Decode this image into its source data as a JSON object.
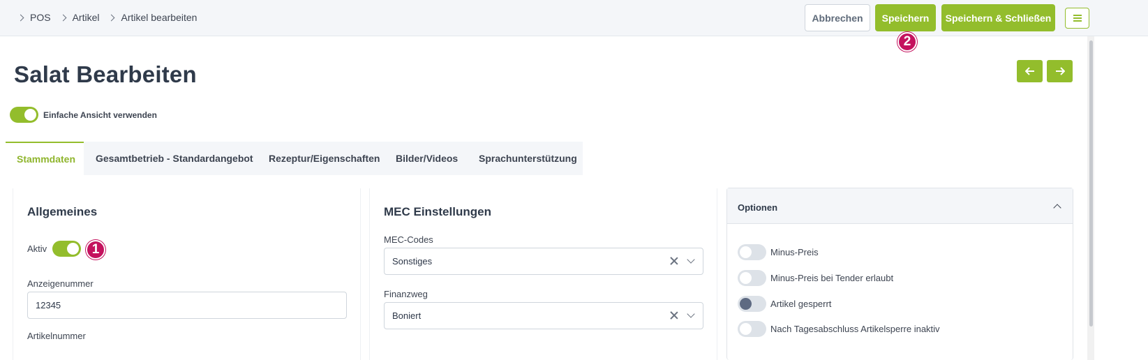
{
  "breadcrumb": [
    "POS",
    "Artikel",
    "Artikel bearbeiten"
  ],
  "header": {
    "cancel_label": "Abbrechen",
    "save_label": "Speichern",
    "save_close_label": "Speichern & Schließen"
  },
  "markers": {
    "one": "1",
    "two": "2"
  },
  "page_title": "Salat Bearbeiten",
  "simple_view": {
    "label": "Einfache Ansicht verwenden",
    "enabled": true
  },
  "tabs": [
    {
      "label": "Stammdaten",
      "active": true
    },
    {
      "label": "Gesamtbetrieb - Standardangebot",
      "active": false
    },
    {
      "label": "Rezeptur/Eigenschaften",
      "active": false
    },
    {
      "label": "Bilder/Videos",
      "active": false
    },
    {
      "label": "Sprachunterstützung",
      "active": false
    }
  ],
  "general": {
    "title": "Allgemeines",
    "active_label": "Aktiv",
    "active": true,
    "display_number_label": "Anzeigenummer",
    "display_number_value": "12345",
    "article_number_label": "Artikelnummer"
  },
  "mec": {
    "title": "MEC Einstellungen",
    "codes_label": "MEC-Codes",
    "codes_value": "Sonstiges",
    "finance_label": "Finanzweg",
    "finance_value": "Boniert"
  },
  "options": {
    "title": "Optionen",
    "items": [
      {
        "label": "Minus-Preis",
        "state": "off"
      },
      {
        "label": "Minus-Preis bei Tender erlaubt",
        "state": "off"
      },
      {
        "label": "Artikel gesperrt",
        "state": "locked"
      },
      {
        "label": "Nach Tagesabschluss Artikelsperre inaktiv",
        "state": "off"
      }
    ]
  },
  "colors": {
    "accent": "#93bd2c",
    "marker": "#c4125e",
    "text": "#2f3a4a"
  }
}
